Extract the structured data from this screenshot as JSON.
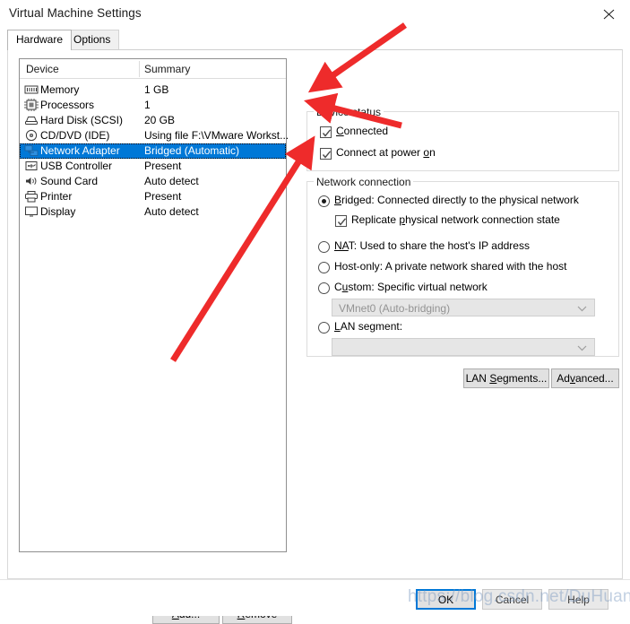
{
  "window": {
    "title": "Virtual Machine Settings",
    "close_icon": "close-icon"
  },
  "tabs": [
    {
      "label": "Hardware",
      "active": true
    },
    {
      "label": "Options",
      "active": false
    }
  ],
  "device_list": {
    "columns": [
      "Device",
      "Summary"
    ],
    "rows": [
      {
        "icon": "memory-icon",
        "name": "Memory",
        "summary": "1 GB",
        "selected": false
      },
      {
        "icon": "processor-icon",
        "name": "Processors",
        "summary": "1",
        "selected": false
      },
      {
        "icon": "harddisk-icon",
        "name": "Hard Disk (SCSI)",
        "summary": "20 GB",
        "selected": false
      },
      {
        "icon": "cddvd-icon",
        "name": "CD/DVD (IDE)",
        "summary": "Using file F:\\VMware Workst...",
        "selected": false
      },
      {
        "icon": "network-icon",
        "name": "Network Adapter",
        "summary": "Bridged (Automatic)",
        "selected": true
      },
      {
        "icon": "usb-icon",
        "name": "USB Controller",
        "summary": "Present",
        "selected": false
      },
      {
        "icon": "soundcard-icon",
        "name": "Sound Card",
        "summary": "Auto detect",
        "selected": false
      },
      {
        "icon": "printer-icon",
        "name": "Printer",
        "summary": "Present",
        "selected": false
      },
      {
        "icon": "display-icon",
        "name": "Display",
        "summary": "Auto detect",
        "selected": false
      }
    ]
  },
  "list_buttons": {
    "add": "Add...",
    "add_mnemonic": "A",
    "remove": "Remove",
    "remove_mnemonic": "R"
  },
  "device_status": {
    "group_label": "Device status",
    "checkboxes": [
      {
        "label_pre": "",
        "mnemonic": "C",
        "label_post": "onnected",
        "checked": true
      },
      {
        "label_pre": "Connect at power ",
        "mnemonic": "o",
        "label_post": "n",
        "checked": true
      }
    ]
  },
  "network_connection": {
    "group_label": "Network connection",
    "options": [
      {
        "label_pre": "",
        "mnemonic": "B",
        "label_post": "ridged: Connected directly to the physical network",
        "checked": true
      },
      {
        "label_pre": "",
        "mnemonic": "NA",
        "label_post": "T: Used to share the host's IP address",
        "checked": false
      },
      {
        "label_pre": "Host-only",
        "mnemonic": "",
        "label_post": ": A private network shared with the host",
        "checked": false
      },
      {
        "label_pre": "C",
        "mnemonic": "u",
        "label_post": "stom: Specific virtual network",
        "checked": false
      },
      {
        "label_pre": "",
        "mnemonic": "L",
        "label_post": "AN segment:",
        "checked": false
      }
    ],
    "replicate_checkbox": {
      "label_pre": "Replicate ",
      "mnemonic": "p",
      "label_post": "hysical network connection state",
      "checked": true
    },
    "custom_combo": {
      "value": "VMnet0 (Auto-bridging)",
      "disabled": true
    },
    "lansegment_combo": {
      "value": "",
      "disabled": true
    }
  },
  "network_buttons": {
    "lan_segments_pre": "LAN ",
    "lan_segments_mnemonic": "S",
    "lan_segments_post": "egments...",
    "advanced_pre": "Ad",
    "advanced_mnemonic": "v",
    "advanced_post": "anced..."
  },
  "footer_buttons": {
    "ok": "OK",
    "cancel": "Cancel",
    "help": "Help"
  },
  "watermark": {
    "text": "https://blog.csdn.net/DuHuangod"
  },
  "colors": {
    "selection_blue": "#0078d7",
    "annotation_red": "#ee2b2b",
    "button_face": "#e1e1e1",
    "disabled_text": "#939393"
  },
  "annotations": [
    {
      "name": "arrow-to-connected-checkbox",
      "target": "Connected checkbox"
    },
    {
      "name": "arrow-to-connect-at-power-on",
      "target": "Connect at power on checkbox"
    },
    {
      "name": "arrow-to-bridged-radio",
      "target": "Bridged radio button"
    }
  ]
}
